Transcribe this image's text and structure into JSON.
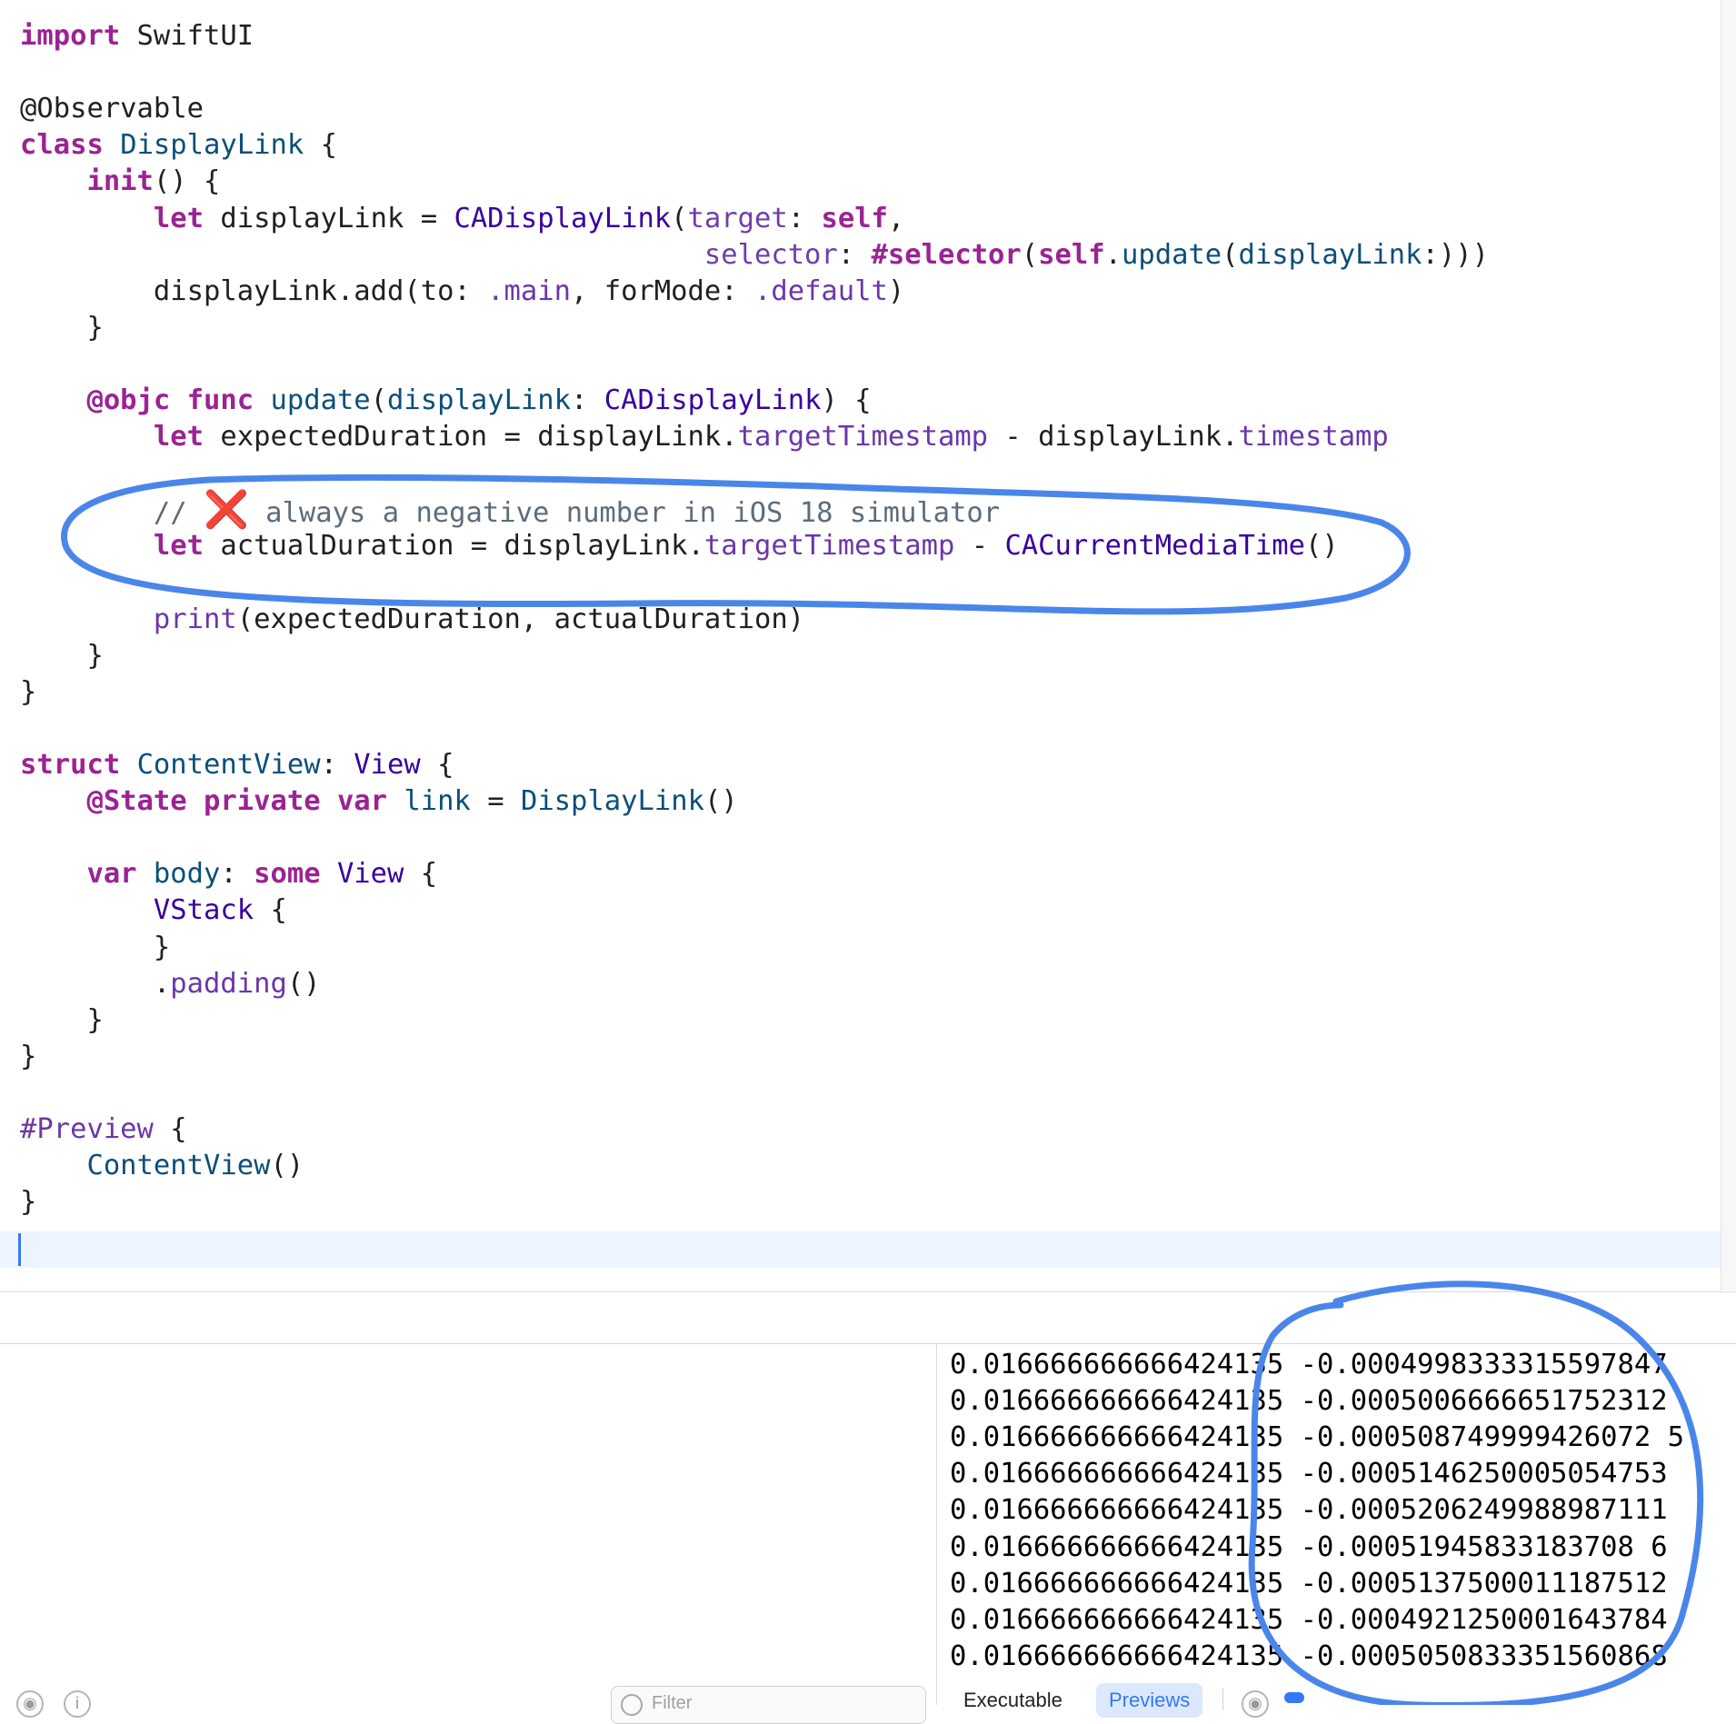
{
  "editor": {
    "code_lines": [
      [
        {
          "t": "import",
          "c": "kw"
        },
        {
          "t": " SwiftUI",
          "c": ""
        }
      ],
      [],
      [
        {
          "t": "@Observable",
          "c": ""
        }
      ],
      [
        {
          "t": "class",
          "c": "kw"
        },
        {
          "t": " ",
          "c": ""
        },
        {
          "t": "DisplayLink",
          "c": "ty"
        },
        {
          "t": " {",
          "c": ""
        }
      ],
      [
        {
          "t": "    ",
          "c": ""
        },
        {
          "t": "init",
          "c": "kw"
        },
        {
          "t": "() {",
          "c": ""
        }
      ],
      [
        {
          "t": "        ",
          "c": ""
        },
        {
          "t": "let",
          "c": "kw"
        },
        {
          "t": " displayLink = ",
          "c": ""
        },
        {
          "t": "CADisplayLink",
          "c": "sy"
        },
        {
          "t": "(",
          "c": ""
        },
        {
          "t": "target",
          "c": "ac"
        },
        {
          "t": ": ",
          "c": ""
        },
        {
          "t": "self",
          "c": "kw"
        },
        {
          "t": ",",
          "c": ""
        }
      ],
      [
        {
          "t": "                                         ",
          "c": ""
        },
        {
          "t": "selector",
          "c": "ac"
        },
        {
          "t": ": ",
          "c": ""
        },
        {
          "t": "#selector",
          "c": "kw"
        },
        {
          "t": "(",
          "c": ""
        },
        {
          "t": "self",
          "c": "kw"
        },
        {
          "t": ".",
          "c": ""
        },
        {
          "t": "update",
          "c": "ty"
        },
        {
          "t": "(",
          "c": ""
        },
        {
          "t": "displayLink",
          "c": "ty"
        },
        {
          "t": ":)))",
          "c": ""
        }
      ],
      [
        {
          "t": "        displayLink.add(to: ",
          "c": ""
        },
        {
          "t": ".main",
          "c": "me"
        },
        {
          "t": ", forMode: ",
          "c": ""
        },
        {
          "t": ".default",
          "c": "me"
        },
        {
          "t": ")",
          "c": ""
        }
      ],
      [
        {
          "t": "    }",
          "c": ""
        }
      ],
      [],
      [
        {
          "t": "    ",
          "c": ""
        },
        {
          "t": "@objc",
          "c": "kw"
        },
        {
          "t": " ",
          "c": ""
        },
        {
          "t": "func",
          "c": "kw"
        },
        {
          "t": " ",
          "c": ""
        },
        {
          "t": "update",
          "c": "ty"
        },
        {
          "t": "(",
          "c": ""
        },
        {
          "t": "displayLink",
          "c": "ty"
        },
        {
          "t": ": ",
          "c": ""
        },
        {
          "t": "CADisplayLink",
          "c": "sy"
        },
        {
          "t": ") {",
          "c": ""
        }
      ],
      [
        {
          "t": "        ",
          "c": ""
        },
        {
          "t": "let",
          "c": "kw"
        },
        {
          "t": " expectedDuration = displayLink.",
          "c": ""
        },
        {
          "t": "targetTimestamp",
          "c": "me"
        },
        {
          "t": " - displayLink.",
          "c": ""
        },
        {
          "t": "timestamp",
          "c": "me"
        }
      ],
      [],
      [
        {
          "t": "        // ",
          "c": "cm"
        },
        {
          "t": "❌",
          "c": "x-icon"
        },
        {
          "t": " always a negative number in iOS 18 simulator",
          "c": "cm"
        }
      ],
      [
        {
          "t": "        ",
          "c": ""
        },
        {
          "t": "let",
          "c": "kw"
        },
        {
          "t": " actualDuration = displayLink.",
          "c": ""
        },
        {
          "t": "targetTimestamp",
          "c": "me"
        },
        {
          "t": " - ",
          "c": ""
        },
        {
          "t": "CACurrentMediaTime",
          "c": "sy"
        },
        {
          "t": "()",
          "c": ""
        }
      ],
      [],
      [
        {
          "t": "        ",
          "c": ""
        },
        {
          "t": "print",
          "c": "me"
        },
        {
          "t": "(expectedDuration, actualDuration)",
          "c": ""
        }
      ],
      [
        {
          "t": "    }",
          "c": ""
        }
      ],
      [
        {
          "t": "}",
          "c": ""
        }
      ],
      [],
      [
        {
          "t": "struct",
          "c": "kw"
        },
        {
          "t": " ",
          "c": ""
        },
        {
          "t": "ContentView",
          "c": "ty"
        },
        {
          "t": ": ",
          "c": ""
        },
        {
          "t": "View",
          "c": "sy"
        },
        {
          "t": " {",
          "c": ""
        }
      ],
      [
        {
          "t": "    ",
          "c": ""
        },
        {
          "t": "@State",
          "c": "kw"
        },
        {
          "t": " ",
          "c": ""
        },
        {
          "t": "private",
          "c": "kw"
        },
        {
          "t": " ",
          "c": ""
        },
        {
          "t": "var",
          "c": "kw"
        },
        {
          "t": " ",
          "c": ""
        },
        {
          "t": "link",
          "c": "ty"
        },
        {
          "t": " = ",
          "c": ""
        },
        {
          "t": "DisplayLink",
          "c": "ty"
        },
        {
          "t": "()",
          "c": ""
        }
      ],
      [],
      [
        {
          "t": "    ",
          "c": ""
        },
        {
          "t": "var",
          "c": "kw"
        },
        {
          "t": " ",
          "c": ""
        },
        {
          "t": "body",
          "c": "ty"
        },
        {
          "t": ": ",
          "c": ""
        },
        {
          "t": "some",
          "c": "kw"
        },
        {
          "t": " ",
          "c": ""
        },
        {
          "t": "View",
          "c": "sy"
        },
        {
          "t": " {",
          "c": ""
        }
      ],
      [
        {
          "t": "        ",
          "c": ""
        },
        {
          "t": "VStack",
          "c": "sy"
        },
        {
          "t": " {",
          "c": ""
        }
      ],
      [
        {
          "t": "        }",
          "c": ""
        }
      ],
      [
        {
          "t": "        .",
          "c": ""
        },
        {
          "t": "padding",
          "c": "me"
        },
        {
          "t": "()",
          "c": ""
        }
      ],
      [
        {
          "t": "    }",
          "c": ""
        }
      ],
      [
        {
          "t": "}",
          "c": ""
        }
      ],
      [],
      [
        {
          "t": "#Preview",
          "c": "me"
        },
        {
          "t": " {",
          "c": ""
        }
      ],
      [
        {
          "t": "    ",
          "c": ""
        },
        {
          "t": "ContentView",
          "c": "ty"
        },
        {
          "t": "()",
          "c": ""
        }
      ],
      [
        {
          "t": "}",
          "c": ""
        }
      ]
    ]
  },
  "console": {
    "lines": [
      "0.016666666666424135 -0.0004998333315597847",
      "0.016666666666424135 -0.0005006666651752312",
      "0.016666666666424135 -0.000508749999426072 5",
      "0.016666666666424135 -0.0005146250005054753",
      "0.016666666666424135 -0.0005206249988987111",
      "0.016666666666424135 -0.00051945833183708 6",
      "0.016666666666424135 -0.0005137500011187512",
      "0.016666666666424135 -0.0004921250001643784",
      "0.016666666666424135 -0.0005050833351560868"
    ]
  },
  "bottom_bar": {
    "filter_placeholder": "Filter",
    "tab_executable": "Executable",
    "tab_previews": "Previews"
  },
  "colors": {
    "keyword": "#9b2393",
    "type": "#0b4f79",
    "system_type": "#3900a0",
    "member": "#6c36a9",
    "comment": "#5d6c79",
    "annotation": "#4a86ea"
  }
}
